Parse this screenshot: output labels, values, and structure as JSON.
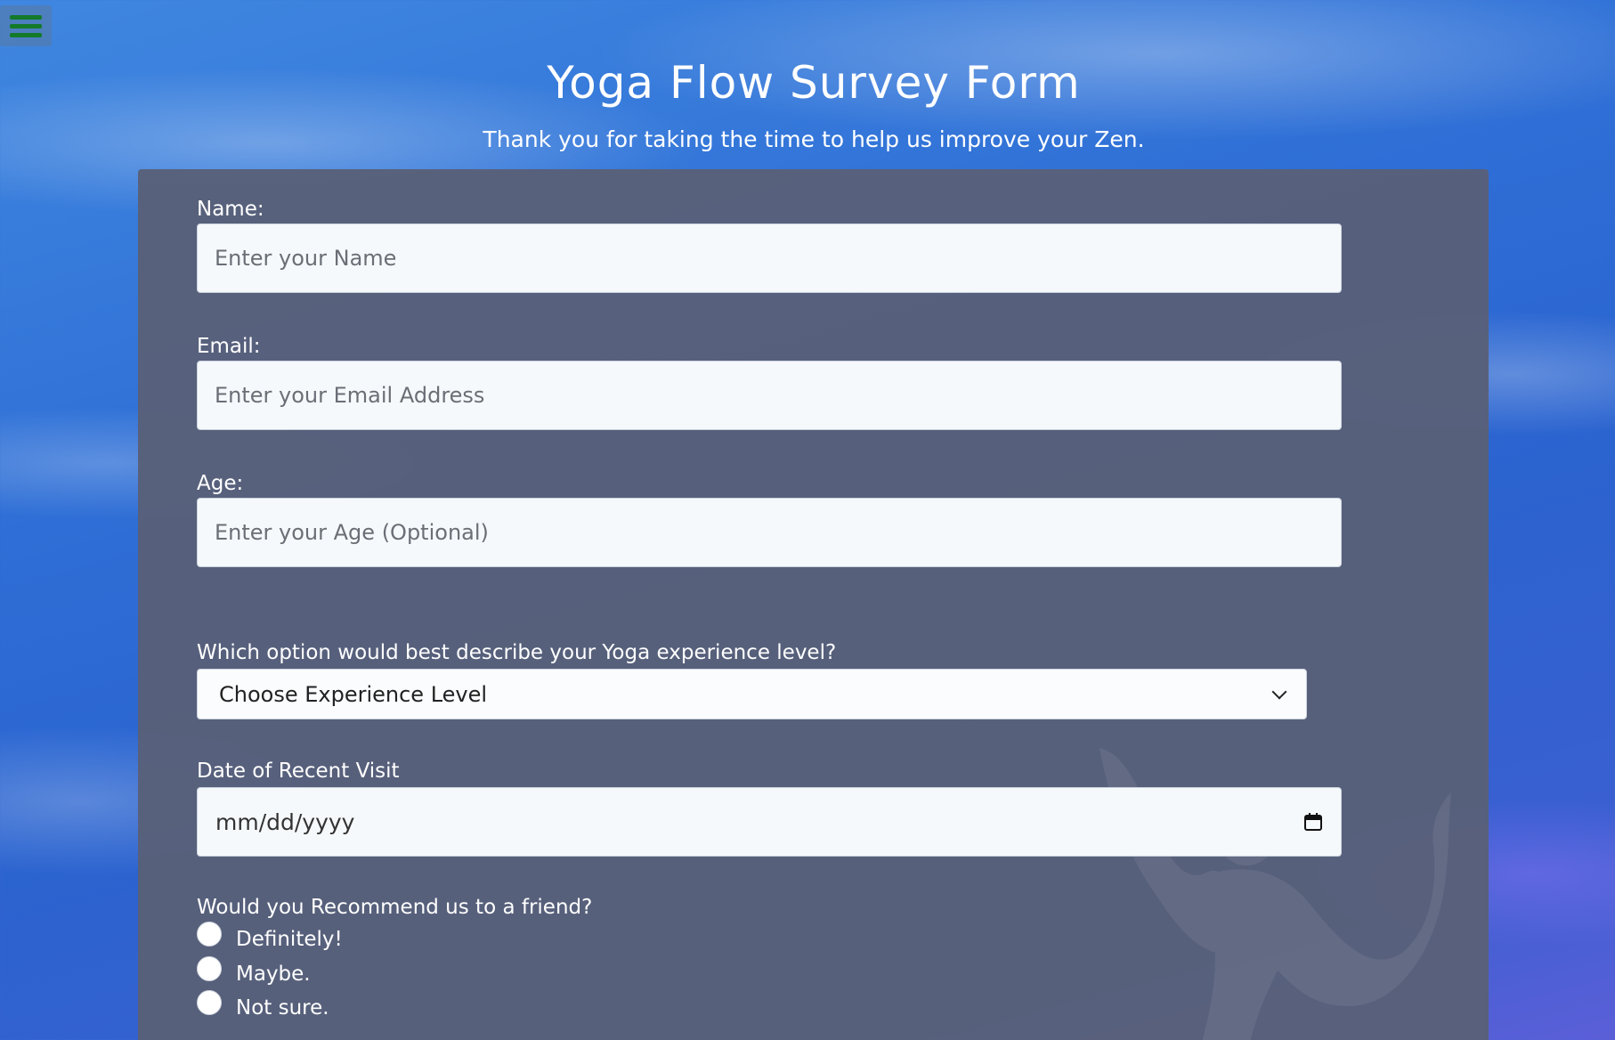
{
  "nav": {
    "menu_icon": "hamburger-menu-icon"
  },
  "header": {
    "title": "Yoga Flow Survey Form",
    "subtitle": "Thank you for taking the time to help us improve your Zen."
  },
  "form": {
    "name": {
      "label": "Name:",
      "placeholder": "Enter your Name",
      "value": ""
    },
    "email": {
      "label": "Email:",
      "placeholder": "Enter your Email Address",
      "value": ""
    },
    "age": {
      "label": "Age:",
      "placeholder": "Enter your Age (Optional)",
      "value": ""
    },
    "experience": {
      "label": "Which option would best describe your Yoga experience level?",
      "selected": "Choose Experience Level",
      "icon": "chevron-down-icon"
    },
    "visit_date": {
      "label": "Date of Recent Visit",
      "value": "mm/dd/yyyy",
      "icon": "calendar-icon"
    },
    "recommend": {
      "label": "Would you Recommend us to a friend?",
      "options": [
        "Definitely!",
        "Maybe.",
        "Not sure."
      ]
    }
  },
  "colors": {
    "panel": "#586078",
    "menu_bar": "#137a2a",
    "background": "#2f6fd6"
  }
}
